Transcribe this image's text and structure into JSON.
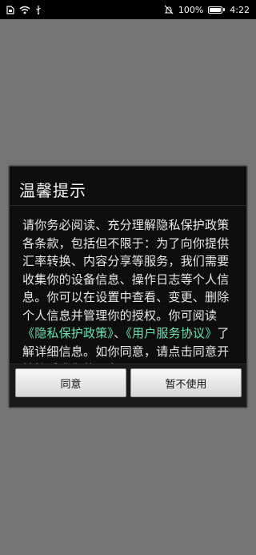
{
  "status_bar": {
    "battery_text": "100%",
    "time": "4:22",
    "battery_level": 1.0
  },
  "dialog": {
    "title": "温馨提示",
    "body_part1": "请你务必阅读、充分理解隐私保护政策各条款，包括但不限于：为了向你提供汇率转换、内容分享等服务，我们需要收集你的设备信息、操作日志等个人信息。你可以在设置中查看、变更、删除个人信息并管理你的授权。你可阅读",
    "privacy_link": "《隐私保护政策》",
    "sep": "、",
    "terms_link": "《用户服务协议》",
    "body_part2": "了解详细信息。如你同意，请点击同意开始接受我们的服务",
    "agree_label": "同意",
    "decline_label": "暂不使用",
    "link_color": "#6ee0b5"
  }
}
